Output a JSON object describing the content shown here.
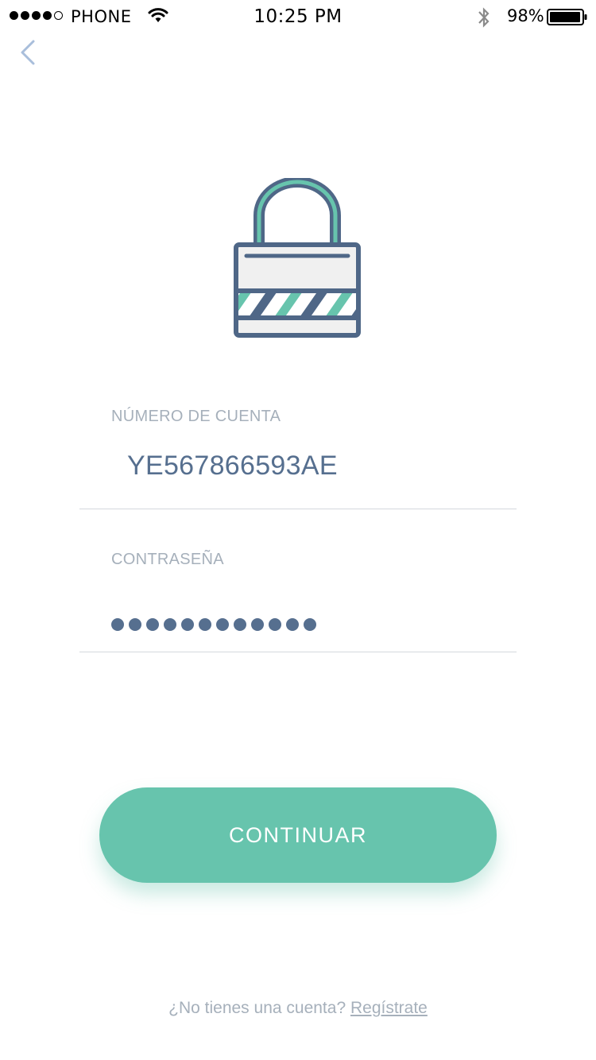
{
  "status_bar": {
    "carrier": "PHONE",
    "signal_bars_filled": 4,
    "signal_bars_total": 5,
    "time": "10:25 PM",
    "battery_percent": "98%",
    "icons": [
      "wifi-icon",
      "bluetooth-icon",
      "battery-icon"
    ]
  },
  "nav": {
    "back_icon": "chevron-left-icon"
  },
  "illustration": {
    "icon": "padlock-icon",
    "colors": {
      "outline": "#4f6787",
      "accent": "#67c4ad",
      "fill": "#f0f0f0"
    }
  },
  "form": {
    "account": {
      "label": "NÚMERO DE CUENTA",
      "value": "YE567866593AE"
    },
    "password": {
      "label": "CONTRASEÑA",
      "masked_length": 12
    }
  },
  "actions": {
    "continue_label": "CONTINUAR"
  },
  "footer": {
    "prompt": "¿No tienes una cuenta?",
    "register_label": "Regístrate"
  },
  "colors": {
    "accent": "#67c4ad",
    "primary_text": "#566f8f",
    "muted_text": "#a6b0bb",
    "divider": "#d4d8dd"
  }
}
